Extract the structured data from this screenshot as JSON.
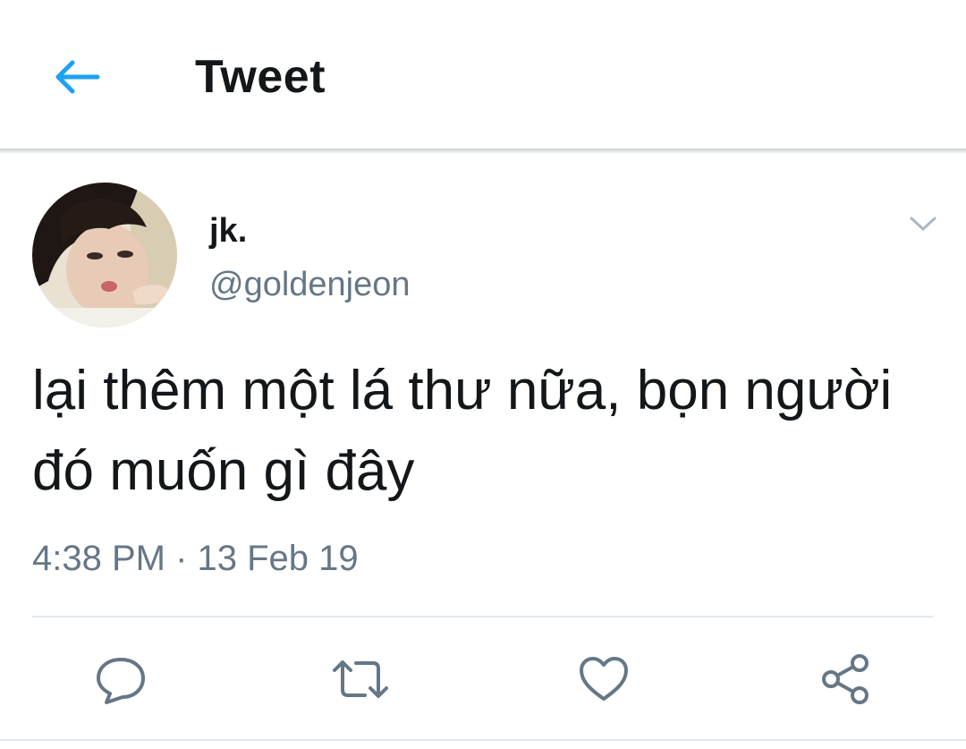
{
  "header": {
    "title": "Tweet",
    "back_icon": "arrow-left-icon",
    "accent_color": "#1da1f2"
  },
  "tweet": {
    "author_name": "jk.",
    "author_handle": "@goldenjeon",
    "text": "lại thêm một lá thư nữa, bọn người đó muốn gì đây",
    "timestamp": "4:38 PM · 13 Feb 19",
    "menu_icon": "chevron-down-icon"
  },
  "actions": [
    {
      "name": "reply",
      "icon": "comment-icon"
    },
    {
      "name": "retweet",
      "icon": "retweet-icon"
    },
    {
      "name": "like",
      "icon": "heart-icon"
    },
    {
      "name": "share",
      "icon": "share-icon"
    }
  ],
  "colors": {
    "text_primary": "#14171a",
    "text_secondary": "#657786",
    "divider": "#e1e8ed",
    "icon_gray": "#657786"
  }
}
